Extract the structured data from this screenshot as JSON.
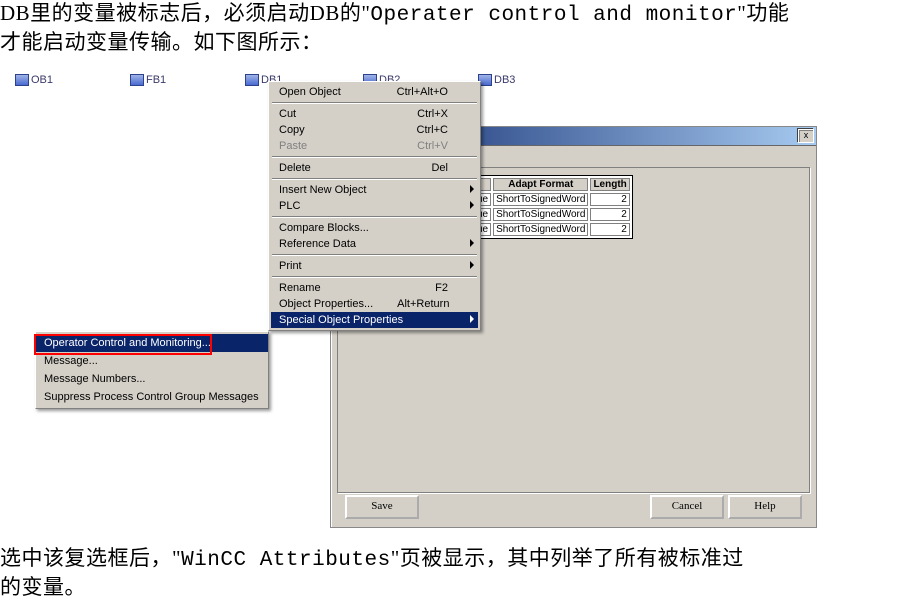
{
  "doc": {
    "para1_line1_prefix": "DB里的变量被标志后，必须启动DB的\"",
    "para1_line1_mono": "Operater control and monitor",
    "para1_line1_suffix": "\"功能",
    "para1_line2": "才能启动变量传输。如下图所示：",
    "para2_prefix": "选中该复选框后，\"",
    "para2_mono": "WinCC Attributes",
    "para2_suffix": "\"页被显示，其中列举了所有被标准过",
    "para2_line2": "的变量。"
  },
  "icons": {
    "ob1": "OB1",
    "fb1": "FB1",
    "db1": "DB1",
    "db2": "DB2",
    "db3": "DB3"
  },
  "menu": {
    "open_object": "Open Object",
    "open_object_sc": "Ctrl+Alt+O",
    "cut": "Cut",
    "cut_sc": "Ctrl+X",
    "copy": "Copy",
    "copy_sc": "Ctrl+C",
    "paste": "Paste",
    "paste_sc": "Ctrl+V",
    "delete": "Delete",
    "delete_sc": "Del",
    "insert_new": "Insert New Object",
    "plc": "PLC",
    "compare": "Compare Blocks...",
    "refdata": "Reference Data",
    "print": "Print",
    "rename": "Rename",
    "rename_sc": "F2",
    "objprops": "Object Properties...",
    "objprops_sc": "Alt+Return",
    "special": "Special Object Properties"
  },
  "submenu": {
    "operator": "Operator Control and Monitoring...",
    "message": "Message...",
    "msg_numbers": "Message Numbers...",
    "suppress": "Suppress Process Control Group Messages"
  },
  "dialog": {
    "close_x": "x",
    "col1": "Adapt Format",
    "col2": "Length",
    "rowcol0": "ue",
    "row1": "ShortToSignedWord",
    "row1len": "2",
    "row2": "ShortToSignedWord",
    "row2len": "2",
    "row3": "ShortToSignedWord",
    "row3len": "2",
    "save": "Save",
    "cancel": "Cancel",
    "help": "Help"
  }
}
